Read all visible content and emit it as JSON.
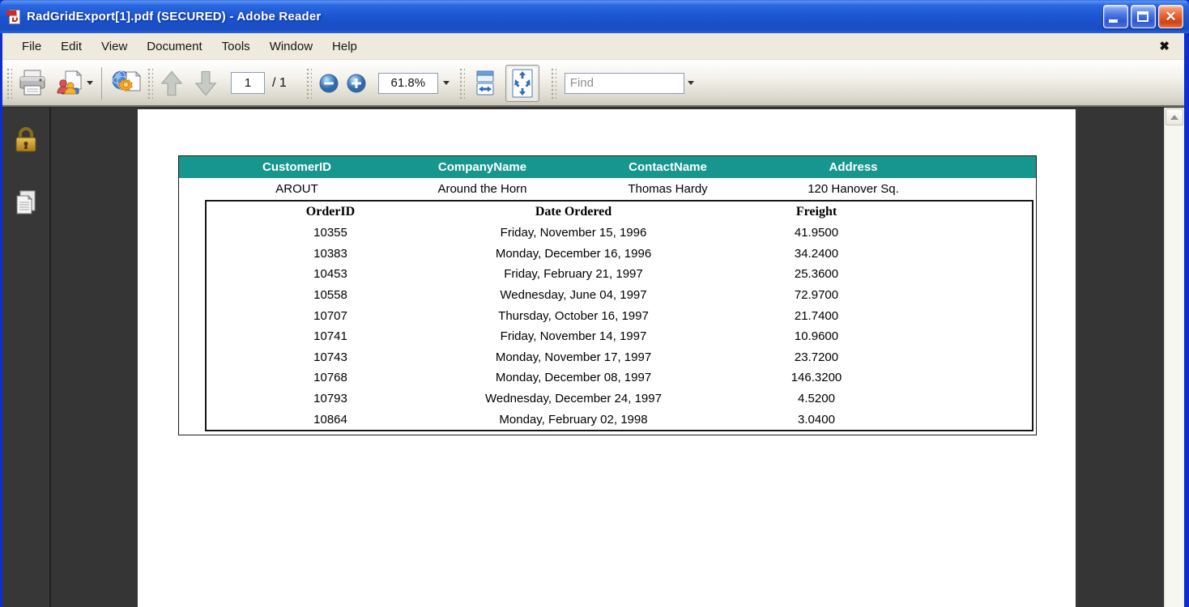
{
  "window": {
    "title": "RadGridExport[1].pdf (SECURED) - Adobe Reader"
  },
  "menubar": {
    "items": [
      "File",
      "Edit",
      "View",
      "Document",
      "Tools",
      "Window",
      "Help"
    ],
    "close_glyph": "✖"
  },
  "toolbar": {
    "page_number": "1",
    "page_total_label": "/ 1",
    "zoom_value": "61.8%",
    "find_placeholder": "Find"
  },
  "pdf": {
    "master_table": {
      "headers": [
        "CustomerID",
        "CompanyName",
        "ContactName",
        "Address"
      ],
      "rows": [
        [
          "AROUT",
          "Around the Horn",
          "Thomas Hardy",
          "120 Hanover Sq."
        ]
      ]
    },
    "detail_table": {
      "headers": [
        "OrderID",
        "Date Ordered",
        "Freight"
      ],
      "rows": [
        [
          "10355",
          "Friday, November 15, 1996",
          "41.9500"
        ],
        [
          "10383",
          "Monday, December 16, 1996",
          "34.2400"
        ],
        [
          "10453",
          "Friday, February 21, 1997",
          "25.3600"
        ],
        [
          "10558",
          "Wednesday, June 04, 1997",
          "72.9700"
        ],
        [
          "10707",
          "Thursday, October 16, 1997",
          "21.7400"
        ],
        [
          "10741",
          "Friday, November 14, 1997",
          "10.9600"
        ],
        [
          "10743",
          "Monday, November 17, 1997",
          "23.7200"
        ],
        [
          "10768",
          "Monday, December 08, 1997",
          "146.3200"
        ],
        [
          "10793",
          "Wednesday, December 24, 1997",
          "4.5200"
        ],
        [
          "10864",
          "Monday, February 02, 1998",
          "3.0400"
        ]
      ]
    }
  },
  "colors": {
    "grid_header_teal": "#17968e",
    "titlebar_blue": "#1b53cf",
    "window_border_blue": "#0b2fd3",
    "canvas_gray": "#353535",
    "close_button_red": "#d24314",
    "lock_gold": "#d9a62e"
  }
}
